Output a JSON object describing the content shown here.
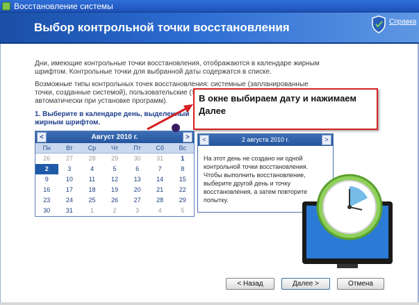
{
  "window": {
    "title": "Восстановление системы"
  },
  "header": {
    "title": "Выбор контрольной точки восстановления",
    "help_link": "Справка"
  },
  "intro_text": "Дни, имеющие контрольные точки восстановления, отображаются в календаре жирным шрифтом. Контрольные точки для выбранной даты содержатся в списке.",
  "types_text": "Возможные типы контрольных точек восстановления: системные (запланированные точки, созданные системой), пользовательские (точки, созданные пользо... автоматически при установке программ).",
  "instruction": "1. Выберите в календаре день, выделенный жирным шрифтом.",
  "calendar": {
    "month": "Август 2010 г.",
    "prev_label": "<",
    "next_label": ">",
    "days_of_week": [
      "Пн",
      "Вт",
      "Ср",
      "Чт",
      "Пт",
      "Сб",
      "Вс"
    ],
    "weeks": [
      [
        {
          "d": "26",
          "o": true
        },
        {
          "d": "27",
          "o": true
        },
        {
          "d": "28",
          "o": true
        },
        {
          "d": "29",
          "o": true
        },
        {
          "d": "30",
          "o": true
        },
        {
          "d": "31",
          "o": true
        },
        {
          "d": "1",
          "b": true
        }
      ],
      [
        {
          "d": "2",
          "s": true
        },
        {
          "d": "3"
        },
        {
          "d": "4"
        },
        {
          "d": "5"
        },
        {
          "d": "6"
        },
        {
          "d": "7"
        },
        {
          "d": "8"
        }
      ],
      [
        {
          "d": "9"
        },
        {
          "d": "10"
        },
        {
          "d": "11"
        },
        {
          "d": "12"
        },
        {
          "d": "13"
        },
        {
          "d": "14"
        },
        {
          "d": "15"
        }
      ],
      [
        {
          "d": "16"
        },
        {
          "d": "17"
        },
        {
          "d": "18"
        },
        {
          "d": "19"
        },
        {
          "d": "20"
        },
        {
          "d": "21"
        },
        {
          "d": "22"
        }
      ],
      [
        {
          "d": "23"
        },
        {
          "d": "24"
        },
        {
          "d": "25"
        },
        {
          "d": "26"
        },
        {
          "d": "27"
        },
        {
          "d": "28"
        },
        {
          "d": "29"
        }
      ],
      [
        {
          "d": "30"
        },
        {
          "d": "31"
        },
        {
          "d": "1",
          "o": true
        },
        {
          "d": "2",
          "o": true
        },
        {
          "d": "3",
          "o": true
        },
        {
          "d": "4",
          "o": true
        },
        {
          "d": "5",
          "o": true
        }
      ]
    ]
  },
  "points_panel": {
    "date": "2 августа 2010 г.",
    "prev_label": "<",
    "next_label": ">",
    "message": "На этот день не создано ни одной контрольной точки восстановления. Чтобы выполнить восстановление, выберите другой день и точку восстановления, а затем повторите попытку."
  },
  "callout": {
    "text": "В окне выбираем дату и нажимаем Далее"
  },
  "buttons": {
    "back": "< Назад",
    "next": "Далее >",
    "cancel": "Отмена"
  },
  "colors": {
    "header_blue": "#2c6cd2",
    "callout_border": "#d42020",
    "selected_day": "#1f5aa8"
  }
}
